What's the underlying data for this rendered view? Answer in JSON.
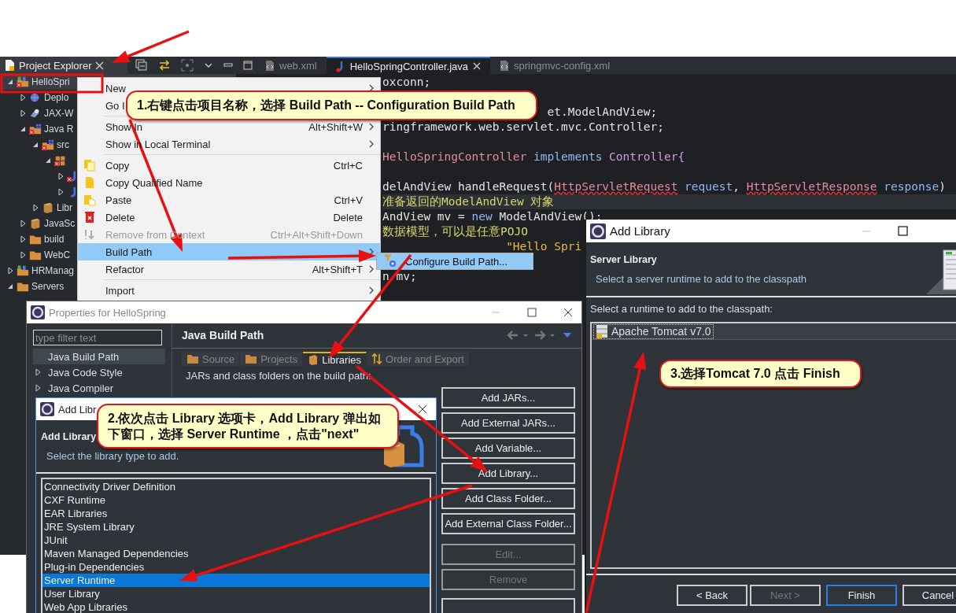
{
  "explorer": {
    "title": "Project Explorer",
    "tree": [
      {
        "label": "HelloSpri",
        "kind": "project",
        "expanded": true,
        "selected": true,
        "error": true,
        "children": [
          {
            "label": "Deplo",
            "kind": "deploy",
            "expanded": false,
            "selected": false,
            "error": false
          },
          {
            "label": "JAX-W",
            "kind": "service",
            "expanded": false,
            "selected": false,
            "error": false
          },
          {
            "label": "Java R",
            "kind": "source",
            "expanded": true,
            "selected": false,
            "error": true,
            "children": [
              {
                "label": "src",
                "kind": "folder-src",
                "expanded": true,
                "selected": false,
                "error": true,
                "children": [
                  {
                    "kind": "package",
                    "expanded": true,
                    "selected": false,
                    "error": true,
                    "children": [
                      {
                        "kind": "java",
                        "expanded": false,
                        "selected": false,
                        "error": true
                      },
                      {
                        "kind": "java",
                        "expanded": false,
                        "selected": false,
                        "error": false
                      }
                    ]
                  }
                ]
              },
              {
                "label": "Libr",
                "kind": "library",
                "expanded": false,
                "selected": false,
                "error": false
              }
            ]
          },
          {
            "label": "JavaSc",
            "kind": "library",
            "expanded": false,
            "selected": false,
            "error": false
          },
          {
            "label": "build",
            "kind": "folder",
            "expanded": false,
            "selected": false,
            "error": false
          },
          {
            "label": "WebC",
            "kind": "folder",
            "expanded": false,
            "selected": false,
            "error": false
          }
        ]
      },
      {
        "label": "HRManag",
        "kind": "project",
        "expanded": false,
        "selected": false,
        "error": false
      },
      {
        "label": "Servers",
        "kind": "folder",
        "expanded": true,
        "selected": false,
        "error": false
      }
    ]
  },
  "editor_tabs": [
    {
      "title": "web.xml",
      "kind": "xml",
      "selected": false,
      "closable": false
    },
    {
      "title": "HelloSpringController.java",
      "kind": "java",
      "selected": true,
      "closable": true
    },
    {
      "title": "springmvc-config.xml",
      "kind": "xml",
      "selected": false,
      "closable": false
    }
  ],
  "code": [
    {
      "kind": "code",
      "current": false,
      "tokens": [
        {
          "text": "oxconn;",
          "kind": "plain"
        }
      ]
    },
    {
      "kind": "blank"
    },
    {
      "current": false,
      "tokens": [
        {
          "text": "                        et.ModelAndView;",
          "kind": "plain"
        }
      ]
    },
    {
      "current": false,
      "tokens": [
        {
          "text": "ringframework.web.servlet.mvc.Controller;",
          "kind": "plain"
        }
      ]
    },
    {
      "kind": "blank"
    },
    {
      "current": false,
      "tokens": [
        {
          "text": "HelloSpringController",
          "kind": "class"
        },
        {
          "text": " implements ",
          "kind": "keyword"
        },
        {
          "text": "Controller{",
          "kind": "type"
        }
      ]
    },
    {
      "kind": "blank"
    },
    {
      "current": false,
      "tokens": [
        {
          "text": "delAndView handleRequest(",
          "kind": "plain"
        },
        {
          "text": "HttpServletRequest",
          "kind": "error"
        },
        {
          "text": " request",
          "kind": "param"
        },
        {
          "text": ", ",
          "kind": "plain"
        },
        {
          "text": "HttpServletResponse",
          "kind": "error"
        },
        {
          "text": " response",
          "kind": "param"
        },
        {
          "text": ")",
          "kind": "plain"
        }
      ]
    },
    {
      "current": true,
      "tokens": [
        {
          "text": "准备返回的ModelAndView 对象",
          "kind": "comment"
        }
      ]
    },
    {
      "current": false,
      "tokens": [
        {
          "text": "AndView mv = ",
          "kind": "plain"
        },
        {
          "text": "new",
          "kind": "keyword"
        },
        {
          "text": " ModelAndView();",
          "kind": "plain"
        }
      ]
    },
    {
      "current": false,
      "tokens": [
        {
          "text": "数据模型，可以是任意POJO",
          "kind": "comment"
        }
      ]
    },
    {
      "current": false,
      "tokens": [
        {
          "text": "                  \"Hello Spri",
          "kind": "string"
        }
      ]
    },
    {
      "kind": "blank"
    },
    {
      "current": false,
      "tokens": [
        {
          "text": "n mv;",
          "kind": "plain"
        }
      ]
    }
  ],
  "context_menu": {
    "sections": [
      [
        {
          "label": "New",
          "kind": "plain",
          "has_submenu": true,
          "disabled": false,
          "selected": false
        },
        {
          "label": "Go I",
          "kind": "plain",
          "disabled": false,
          "selected": false
        }
      ],
      [
        {
          "label": "Show In",
          "shortcut": "Alt+Shift+W",
          "kind": "plain",
          "has_submenu": true,
          "disabled": false,
          "selected": false
        },
        {
          "label": "Show in Local Terminal",
          "kind": "plain",
          "has_submenu": true,
          "disabled": false,
          "selected": false
        }
      ],
      [
        {
          "label": "Copy",
          "shortcut": "Ctrl+C",
          "kind": "copy",
          "has_submenu": false,
          "disabled": false,
          "selected": false
        },
        {
          "label": "Copy Qualified Name",
          "kind": "copy-name",
          "has_submenu": false,
          "disabled": false,
          "selected": false
        },
        {
          "label": "Paste",
          "shortcut": "Ctrl+V",
          "kind": "paste",
          "has_submenu": false,
          "disabled": false,
          "selected": false
        },
        {
          "label": "Delete",
          "shortcut": "Delete",
          "kind": "delete",
          "has_submenu": false,
          "disabled": false,
          "selected": false
        },
        {
          "label": "Remove from Context",
          "shortcut": "Ctrl+Alt+Shift+Down",
          "kind": "remove",
          "has_submenu": false,
          "disabled": true,
          "selected": false
        },
        {
          "label": "Build Path",
          "kind": "plain",
          "has_submenu": true,
          "disabled": false,
          "selected": true
        },
        {
          "label": "Refactor",
          "shortcut": "Alt+Shift+T",
          "kind": "plain",
          "has_submenu": true,
          "disabled": false,
          "selected": false
        }
      ],
      [
        {
          "label": "Import",
          "kind": "plain",
          "has_submenu": true,
          "disabled": false,
          "selected": false
        }
      ]
    ]
  },
  "submenu": {
    "label": "Configure Build Path...",
    "selected": true
  },
  "callouts": [
    {
      "text": "1.右键点击项目名称，选择 Build Path -- Configuration Build Path"
    },
    {
      "text": "2.依次点击 Library 选项卡，Add Library 弹出如下窗口，选择 Server Runtime ，点击\"next\""
    },
    {
      "text": "3.选择Tomcat 7.0 点击 Finish"
    }
  ],
  "properties": {
    "title": "Properties for HelloSpring",
    "filter_placeholder": "type filter text",
    "nav": [
      {
        "label": "Java Build Path",
        "selected": true,
        "expandable": false
      },
      {
        "label": "Java Code Style",
        "selected": false,
        "expandable": true
      },
      {
        "label": "Java Compiler",
        "selected": false,
        "expandable": true
      }
    ],
    "heading": "Java Build Path",
    "tabs": [
      {
        "label": "Source",
        "kind": "source",
        "selected": false
      },
      {
        "label": "Projects",
        "kind": "projects",
        "selected": false
      },
      {
        "label": "Libraries",
        "kind": "libraries",
        "selected": true
      },
      {
        "label": "Order and Export",
        "kind": "order",
        "selected": false
      }
    ],
    "caption": "JARs and class folders on the build path:",
    "button_groups": [
      [
        {
          "label": "Add JARs...",
          "disabled": false
        },
        {
          "label": "Add External JARs...",
          "disabled": false
        },
        {
          "label": "Add Variable...",
          "disabled": false
        },
        {
          "label": "Add Library...",
          "disabled": false
        },
        {
          "label": "Add Class Folder...",
          "disabled": false
        },
        {
          "label": "Add External Class Folder...",
          "disabled": false
        }
      ],
      [
        {
          "label": "Edit...",
          "disabled": true
        },
        {
          "label": "Remove",
          "disabled": true
        }
      ]
    ]
  },
  "add_library_1": {
    "title": "Add Libr",
    "heading": "Add Library",
    "subtitle": "Select the library type to add.",
    "items": [
      {
        "label": "Connectivity Driver Definition",
        "selected": false
      },
      {
        "label": "CXF Runtime",
        "selected": false
      },
      {
        "label": "EAR Libraries",
        "selected": false
      },
      {
        "label": "JRE System Library",
        "selected": false
      },
      {
        "label": "JUnit",
        "selected": false
      },
      {
        "label": "Maven Managed Dependencies",
        "selected": false
      },
      {
        "label": "Plug-in Dependencies",
        "selected": false
      },
      {
        "label": "Server Runtime",
        "selected": true
      },
      {
        "label": "User Library",
        "selected": false
      },
      {
        "label": "Web App Libraries",
        "selected": false
      }
    ]
  },
  "add_library_2": {
    "title": "Add Library",
    "heading": "Server Library",
    "subtitle": "Select a server runtime to add to the classpath",
    "caption": "Select a runtime to add to the classpath:",
    "items": [
      {
        "label": "Apache Tomcat v7.0",
        "selected": true
      }
    ],
    "buttons": [
      {
        "label": "< Back",
        "disabled": false,
        "default": false
      },
      {
        "label": "Next >",
        "disabled": true,
        "default": false
      },
      {
        "label": "Finish",
        "disabled": false,
        "default": true
      },
      {
        "label": "Cancel",
        "disabled": false,
        "default": false
      }
    ]
  }
}
